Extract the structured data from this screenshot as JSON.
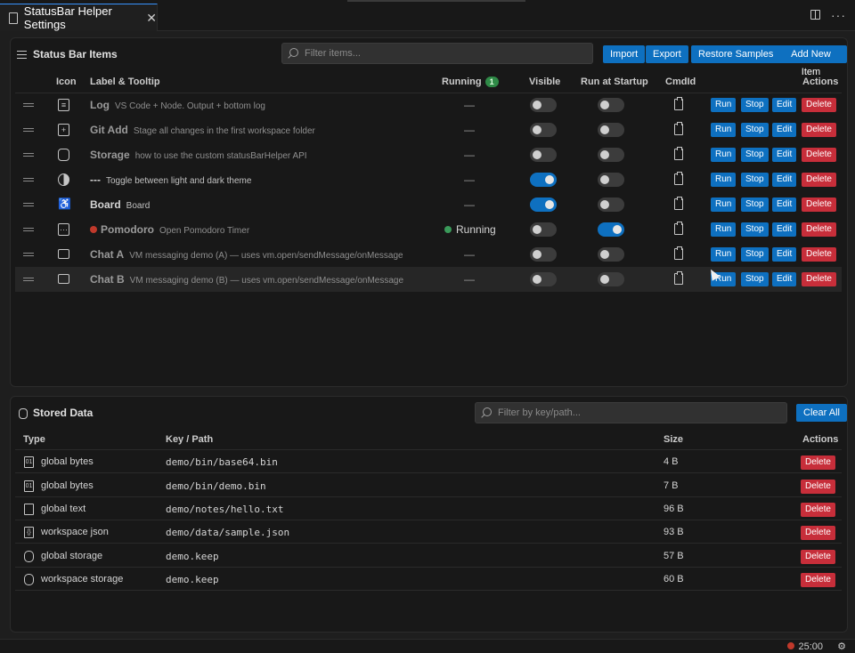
{
  "tab": {
    "title": "StatusBar Helper Settings",
    "close": "✕"
  },
  "items_panel": {
    "title": "Status Bar Items",
    "filter_placeholder": "Filter items...",
    "buttons": {
      "import": "Import",
      "export": "Export",
      "restore": "Restore Samples",
      "add": "Add New Item"
    },
    "headers": {
      "icon": "Icon",
      "label": "Label & Tooltip",
      "running": "Running",
      "running_count": "1",
      "visible": "Visible",
      "startup": "Run at Startup",
      "cmdid": "CmdId",
      "actions": "Actions"
    },
    "actions": {
      "run": "Run",
      "stop": "Stop",
      "edit": "Edit",
      "delete": "Delete"
    },
    "rows": [
      {
        "icon": "output-icon",
        "name": "Log",
        "tooltip": "VS Code + Node. Output + bottom log",
        "running": "—",
        "visible": false,
        "startup": false
      },
      {
        "icon": "add-icon",
        "name": "Git Add",
        "tooltip": "Stage all changes in the first workspace folder",
        "running": "—",
        "visible": false,
        "startup": false
      },
      {
        "icon": "database-icon",
        "name": "Storage",
        "tooltip": "how to use the custom statusBarHelper API",
        "running": "—",
        "visible": false,
        "startup": false
      },
      {
        "icon": "contrast-icon",
        "name": "---",
        "tooltip": "Toggle between light and dark theme",
        "running": "—",
        "visible": true,
        "startup": false
      },
      {
        "icon": "accessibility-icon",
        "name": "Board",
        "tooltip": "Board",
        "running": "—",
        "visible": true,
        "startup": false
      },
      {
        "icon": "ellipsis-icon",
        "name": "Pomodoro",
        "tooltip": "Open Pomodoro Timer",
        "running": "Running",
        "visible": false,
        "startup": true
      },
      {
        "icon": "comment-icon",
        "name": "Chat A",
        "tooltip": "VM messaging demo (A) — uses vm.open/sendMessage/onMessage",
        "running": "—",
        "visible": false,
        "startup": false
      },
      {
        "icon": "comment-discussion-icon",
        "name": "Chat B",
        "tooltip": "VM messaging demo (B) — uses vm.open/sendMessage/onMessage",
        "running": "—",
        "visible": false,
        "startup": false
      }
    ]
  },
  "stored_panel": {
    "title": "Stored Data",
    "filter_placeholder": "Filter by key/path...",
    "clear_all": "Clear All",
    "headers": {
      "type": "Type",
      "key": "Key / Path",
      "size": "Size",
      "actions": "Actions"
    },
    "delete": "Delete",
    "rows": [
      {
        "icon": "binary-file-icon",
        "type": "global bytes",
        "key": "demo/bin/base64.bin",
        "size": "4 B"
      },
      {
        "icon": "binary-file-icon",
        "type": "global bytes",
        "key": "demo/bin/demo.bin",
        "size": "7 B"
      },
      {
        "icon": "file-icon",
        "type": "global text",
        "key": "demo/notes/hello.txt",
        "size": "96 B"
      },
      {
        "icon": "json-file-icon",
        "type": "workspace json",
        "key": "demo/data/sample.json",
        "size": "93 B"
      },
      {
        "icon": "database-icon",
        "type": "global storage",
        "key": "demo.keep",
        "size": "57 B"
      },
      {
        "icon": "database-icon",
        "type": "workspace storage",
        "key": "demo.keep",
        "size": "60 B"
      }
    ]
  },
  "statusbar": {
    "pomodoro": "25:00"
  },
  "colors": {
    "accent": "#0e70c0",
    "danger": "#c72e3a",
    "running": "#3a9a5a"
  }
}
